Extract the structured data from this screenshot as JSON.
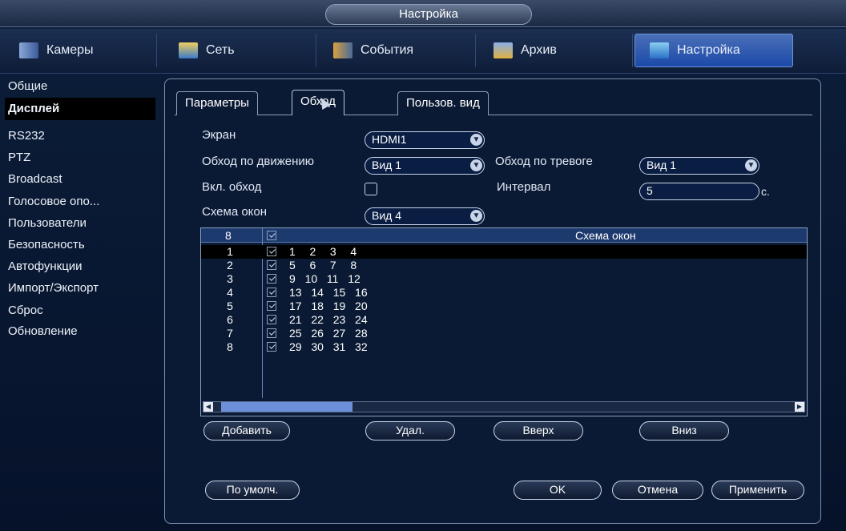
{
  "window": {
    "title": "Настройка"
  },
  "nav": {
    "items": [
      {
        "label": "Камеры",
        "icon": "cameras-icon"
      },
      {
        "label": "Сеть",
        "icon": "network-icon"
      },
      {
        "label": "События",
        "icon": "events-icon"
      },
      {
        "label": "Архив",
        "icon": "archive-icon"
      },
      {
        "label": "Настройка",
        "icon": "settings-icon",
        "active": true
      }
    ]
  },
  "sidebar": {
    "items": [
      {
        "label": "Общие"
      },
      {
        "label": "Дисплей",
        "active": true
      },
      {
        "label": "RS232"
      },
      {
        "label": "PTZ"
      },
      {
        "label": "Broadcast"
      },
      {
        "label": "Голосовое опо..."
      },
      {
        "label": "Пользователи"
      },
      {
        "label": "Безопасность"
      },
      {
        "label": "Автофункции"
      },
      {
        "label": "Импорт/Экспорт"
      },
      {
        "label": "Сброс"
      },
      {
        "label": "Обновление"
      }
    ]
  },
  "tabs": [
    {
      "label": "Параметры"
    },
    {
      "label": "Обход",
      "active": true
    },
    {
      "label": "Пользов. вид"
    }
  ],
  "form": {
    "screen_label": "Экран",
    "screen_value": "HDMI1",
    "motion_tour_label": "Обход по движению",
    "motion_tour_value": "Вид 1",
    "alarm_tour_label": "Обход по тревоге",
    "alarm_tour_value": "Вид 1",
    "enable_tour_label": "Вкл. обход",
    "enable_tour_checked": false,
    "interval_label": "Интервал",
    "interval_value": "5",
    "interval_unit": "с.",
    "window_scheme_label": "Схема окон",
    "window_scheme_value": "Вид 4"
  },
  "table": {
    "header_count": "8",
    "header_scheme": "Схема окон",
    "rows": [
      {
        "n": "1",
        "scheme": "1   2   3   4",
        "selected": true
      },
      {
        "n": "2",
        "scheme": "5   6   7   8"
      },
      {
        "n": "3",
        "scheme": "9  10  11  12"
      },
      {
        "n": "4",
        "scheme": "13  14  15  16"
      },
      {
        "n": "5",
        "scheme": "17  18  19  20"
      },
      {
        "n": "6",
        "scheme": "21  22  23  24"
      },
      {
        "n": "7",
        "scheme": "25  26  27  28"
      },
      {
        "n": "8",
        "scheme": "29  30  31  32"
      }
    ]
  },
  "buttons": {
    "add": "Добавить",
    "delete": "Удал.",
    "up": "Вверх",
    "down": "Вниз",
    "default": "По умолч.",
    "ok": "OK",
    "cancel": "Отмена",
    "apply": "Применить"
  },
  "colors": {
    "accent": "#1c4aa8",
    "background": "#0a1a34"
  }
}
